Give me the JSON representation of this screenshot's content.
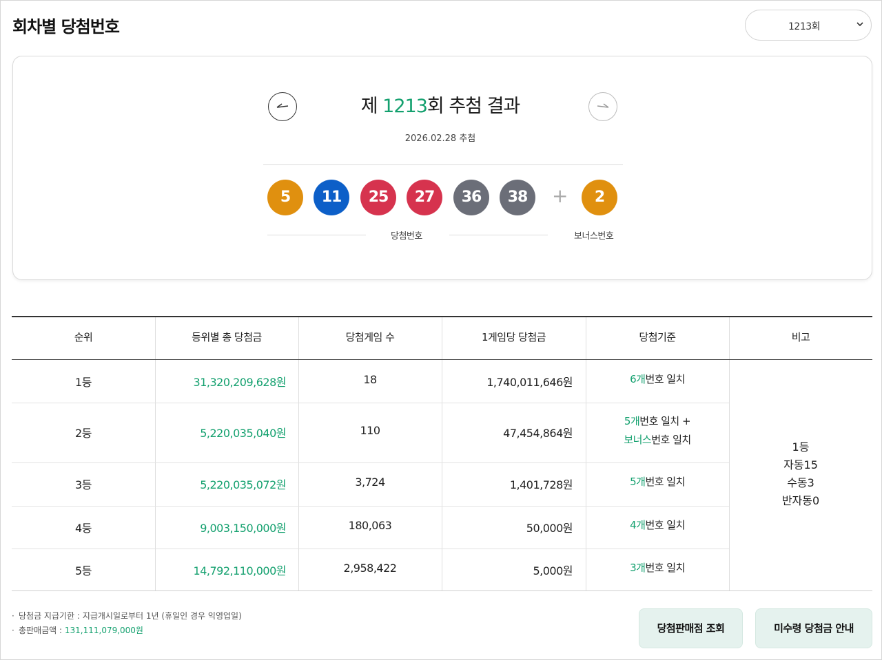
{
  "page_title": "회차별 당첨번호",
  "round_select": {
    "value": "1213회"
  },
  "result": {
    "title_prefix": "제 ",
    "round_number": "1213",
    "title_suffix": "회 추첨 결과",
    "draw_date": "2026.02.28 추첨",
    "balls": [
      {
        "number": "5",
        "color": "#e0900f"
      },
      {
        "number": "11",
        "color": "#0d5fc8"
      },
      {
        "number": "25",
        "color": "#d6334e"
      },
      {
        "number": "27",
        "color": "#d6334e"
      },
      {
        "number": "36",
        "color": "#6b6e78"
      },
      {
        "number": "38",
        "color": "#6b6e78"
      }
    ],
    "plus": "+",
    "bonus": {
      "number": "2",
      "color": "#e0900f"
    },
    "winning_label": "당첨번호",
    "bonus_label": "보너스번호",
    "nav_prev_icon": "arrow-left-icon",
    "nav_next_icon": "arrow-right-icon"
  },
  "table": {
    "headers": [
      "순위",
      "등위별 총 당첨금",
      "당첨게임 수",
      "1게임당 당첨금",
      "당첨기준",
      "비고"
    ],
    "rows": [
      {
        "rank": "1등",
        "total": "31,320,209,628원",
        "count": "18",
        "per_game": "1,740,011,646원",
        "crit_a_g": "6개",
        "crit_a": "번호 일치",
        "crit_b_g": "",
        "crit_b": ""
      },
      {
        "rank": "2등",
        "total": "5,220,035,040원",
        "count": "110",
        "per_game": "47,454,864원",
        "crit_a_g": "5개",
        "crit_a": "번호 일치 +",
        "crit_b_g": "보너스",
        "crit_b": "번호 일치"
      },
      {
        "rank": "3등",
        "total": "5,220,035,072원",
        "count": "3,724",
        "per_game": "1,401,728원",
        "crit_a_g": "5개",
        "crit_a": "번호 일치",
        "crit_b_g": "",
        "crit_b": ""
      },
      {
        "rank": "4등",
        "total": "9,003,150,000원",
        "count": "180,063",
        "per_game": "50,000원",
        "crit_a_g": "4개",
        "crit_a": "번호 일치",
        "crit_b_g": "",
        "crit_b": ""
      },
      {
        "rank": "5등",
        "total": "14,792,110,000원",
        "count": "2,958,422",
        "per_game": "5,000원",
        "crit_a_g": "3개",
        "crit_a": "번호 일치",
        "crit_b_g": "",
        "crit_b": ""
      }
    ],
    "remark_lines": [
      "1등",
      "자동15",
      "수동3",
      "반자동0"
    ]
  },
  "notes": {
    "deadline_label": "당첨금 지급기한 : ",
    "deadline_value": "지급개시일로부터 1년 (휴일인 경우 익영업일)",
    "sales_label": "총판매금액 : ",
    "sales_value": "131,111,079,000원",
    "bullet": "·"
  },
  "buttons": {
    "store_lookup": "당첨판매점 조회",
    "unclaimed_info": "미수령 당첨금 안내"
  },
  "colors": {
    "accent": "#13a06e",
    "button_bg": "#e5f2ee"
  }
}
